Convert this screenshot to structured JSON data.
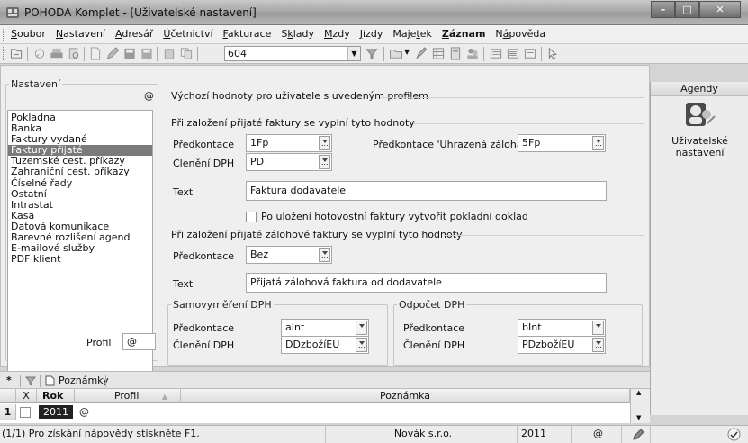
{
  "window": {
    "title": "POHODA Komplet - [Uživatelské nastavení]"
  },
  "menu": [
    {
      "label": "Soubor",
      "accel": "S"
    },
    {
      "label": "Nastavení",
      "accel": "N"
    },
    {
      "label": "Adresář",
      "accel": "A"
    },
    {
      "label": "Účetnictví",
      "accel": "Ú"
    },
    {
      "label": "Fakturace",
      "accel": "F"
    },
    {
      "label": "Sklady",
      "accel": "k"
    },
    {
      "label": "Mzdy",
      "accel": "M"
    },
    {
      "label": "Jízdy",
      "accel": "J"
    },
    {
      "label": "Majetek",
      "accel": "t"
    },
    {
      "label": "Záznam",
      "accel": "Z",
      "bold": true
    },
    {
      "label": "Nápověda",
      "accel": "á"
    }
  ],
  "toolbar": {
    "agenda_value": "604"
  },
  "settings": {
    "legend": "Nastavení",
    "legend_icon": "@",
    "items": [
      "Pokladna",
      "Banka",
      "Faktury vydané",
      "Faktury přijaté",
      "Tuzemské cest. příkazy",
      "Zahraniční cest. příkazy",
      "Číselné řady",
      "Ostatní",
      "Intrastat",
      "Kasa",
      "Datová komunikace",
      "Barevné rozlišení agend",
      "E-mailové služby",
      "PDF klient"
    ],
    "selected_index": 3,
    "profil_label": "Profil",
    "profil_value": "@"
  },
  "defaults": {
    "header": "Výchozí hodnoty pro uživatele s uvedeným profilem",
    "invoice_section": "Při založení přijaté faktury se vyplní tyto hodnoty",
    "predkontace_label": "Předkontace",
    "predkontace_value": "1Fp",
    "cleneni_label": "Členění DPH",
    "cleneni_value": "PD",
    "uhrazena_label": "Předkontace 'Uhrazená záloha'",
    "uhrazena_value": "5Fp",
    "text_label": "Text",
    "text_value": "Faktura dodavatele",
    "checkbox_label": "Po uložení hotovostní faktury vytvořit pokladní doklad",
    "checkbox_checked": false,
    "deposit_section": "Při založení přijaté zálohové faktury se vyplní tyto hodnoty",
    "deposit_predkontace_value": "Bez",
    "deposit_text_value": "Přijatá zálohová faktura od dodavatele",
    "samovymereni": {
      "legend": "Samovyměření DPH",
      "predkontace_label": "Předkontace",
      "predkontace_value": "aInt",
      "cleneni_label": "Členění DPH",
      "cleneni_value": "DDzbožíEU"
    },
    "odpocet": {
      "legend": "Odpočet DPH",
      "predkontace_label": "Předkontace",
      "predkontace_value": "bInt",
      "cleneni_label": "Členění DPH",
      "cleneni_value": "PDzbožíEU"
    }
  },
  "agendy": {
    "header": "Agendy",
    "item_label_1": "Uživatelské",
    "item_label_2": "nastavení"
  },
  "bottom": {
    "tab_star": "*",
    "tab_notes": "Poznámky",
    "columns": [
      "X",
      "Rok",
      "Profil",
      "Poznámka"
    ],
    "row": {
      "index": "1",
      "rok": "2011",
      "profil": "@"
    }
  },
  "status": {
    "help": "(1/1) Pro získání nápovědy stiskněte F1.",
    "company": "Novák s.r.o.",
    "year": "2011",
    "profile": "@"
  }
}
